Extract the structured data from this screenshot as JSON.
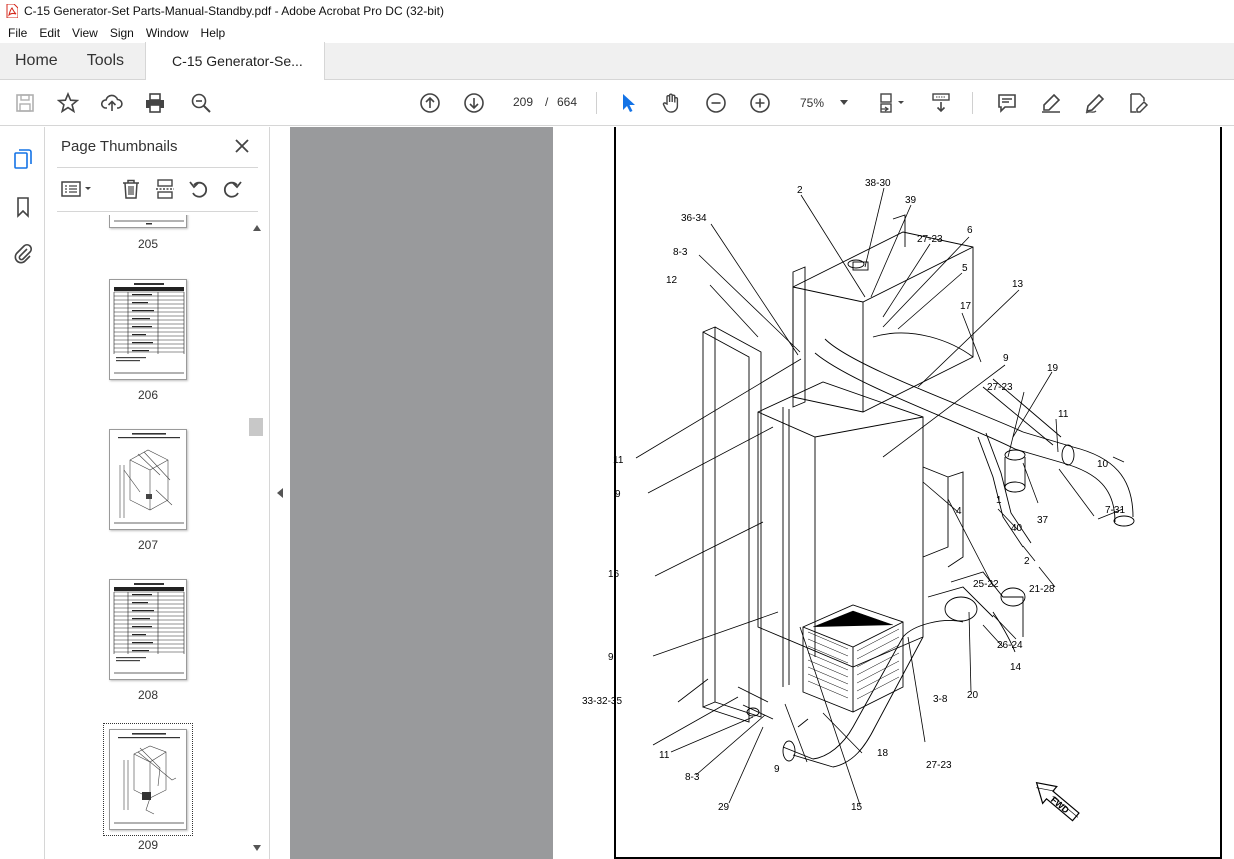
{
  "window": {
    "title": "C-15 Generator-Set Parts-Manual-Standby.pdf - Adobe Acrobat Pro DC (32-bit)"
  },
  "menu": [
    "File",
    "Edit",
    "View",
    "Sign",
    "Window",
    "Help"
  ],
  "tabs": {
    "home": "Home",
    "tools": "Tools",
    "document": "C-15 Generator-Se..."
  },
  "toolbar": {
    "page_current": "209",
    "page_separator": "/",
    "page_total": "664",
    "zoom": "75%",
    "icons": [
      "save-icon",
      "star-icon",
      "upload-icon",
      "print-icon",
      "search-zoom-icon",
      "page-up-icon",
      "page-down-icon",
      "pointer-icon",
      "hand-icon",
      "zoom-out-icon",
      "zoom-in-icon",
      "page-fit-icon",
      "scroll-mode-icon",
      "comment-icon",
      "highlight-icon",
      "sign-icon",
      "edit-icon"
    ]
  },
  "thumbnails_panel": {
    "title": "Page Thumbnails",
    "pages": [
      {
        "label": "205",
        "kind": "table"
      },
      {
        "label": "206",
        "kind": "table"
      },
      {
        "label": "207",
        "kind": "drawing"
      },
      {
        "label": "208",
        "kind": "table"
      },
      {
        "label": "209",
        "kind": "drawing",
        "selected": true
      }
    ]
  },
  "drawing": {
    "callouts": [
      "2",
      "38-30",
      "39",
      "36-34",
      "27-23",
      "6",
      "8-3",
      "5",
      "12",
      "17",
      "13",
      "9",
      "27-23",
      "19",
      "11",
      "11",
      "10",
      "9",
      "1",
      "4",
      "7-31",
      "37",
      "40",
      "16",
      "2",
      "25-22",
      "21-28",
      "26-24",
      "14",
      "9",
      "33-32-35",
      "20",
      "3-8",
      "11",
      "18",
      "27-23",
      "8-3",
      "9",
      "29",
      "15"
    ],
    "direction_label": "FWD"
  },
  "colors": {
    "accent_blue": "#1473e6",
    "doc_background": "#999a9c",
    "panel_border": "#d6d6d6"
  }
}
